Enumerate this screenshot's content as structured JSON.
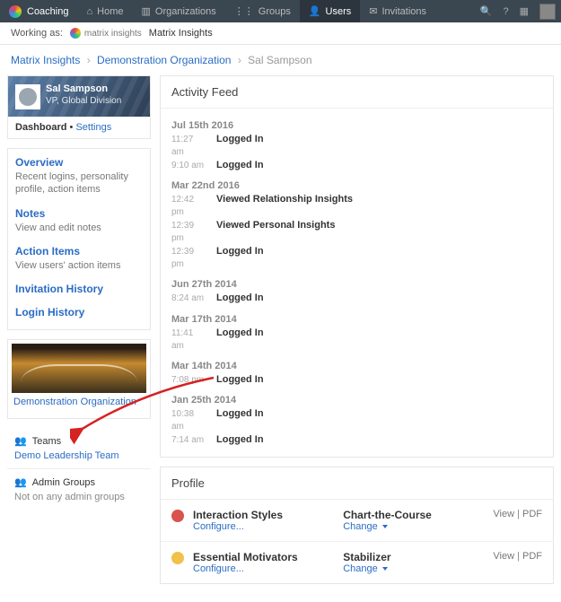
{
  "topnav": {
    "brand": "Coaching",
    "items": [
      {
        "label": "Home",
        "icon": "home-icon"
      },
      {
        "label": "Organizations",
        "icon": "org-icon"
      },
      {
        "label": "Groups",
        "icon": "groups-icon"
      },
      {
        "label": "Users",
        "icon": "user-icon",
        "active": true
      },
      {
        "label": "Invitations",
        "icon": "mail-icon"
      }
    ]
  },
  "working_as": {
    "label": "Working as:",
    "org_name": "Matrix Insights",
    "logo_text": "matrix insights"
  },
  "breadcrumb": {
    "a": "Matrix Insights",
    "b": "Demonstration Organization",
    "c": "Sal Sampson"
  },
  "user": {
    "name": "Sal Sampson",
    "role": "VP, Global Division"
  },
  "dash": {
    "dashboard": "Dashboard",
    "settings": "Settings"
  },
  "sidenav": {
    "overview": {
      "title": "Overview",
      "desc": "Recent logins, personality profile, action items"
    },
    "notes": {
      "title": "Notes",
      "desc": "View and edit notes"
    },
    "actions": {
      "title": "Action Items",
      "desc": "View users' action items"
    },
    "inv": {
      "title": "Invitation History"
    },
    "login": {
      "title": "Login History"
    }
  },
  "org": {
    "name": "Demonstration Organization"
  },
  "teams": {
    "header": "Teams",
    "link": "Demo Leadership Team"
  },
  "admin_groups": {
    "header": "Admin Groups",
    "text": "Not on any admin groups"
  },
  "feed": {
    "header": "Activity Feed",
    "groups": [
      {
        "date": "Jul 15th 2016",
        "rows": [
          {
            "time": "11:27 am",
            "action": "Logged In"
          },
          {
            "time": "9:10 am",
            "action": "Logged In"
          }
        ]
      },
      {
        "date": "Mar 22nd 2016",
        "rows": [
          {
            "time": "12:42 pm",
            "action": "Viewed Relationship Insights"
          },
          {
            "time": "12:39 pm",
            "action": "Viewed Personal Insights"
          },
          {
            "time": "12:39 pm",
            "action": "Logged In"
          }
        ]
      },
      {
        "date": "Jun 27th 2014",
        "rows": [
          {
            "time": "8:24 am",
            "action": "Logged In"
          }
        ]
      },
      {
        "date": "Mar 17th 2014",
        "rows": [
          {
            "time": "11:41 am",
            "action": "Logged In"
          }
        ]
      },
      {
        "date": "Mar 14th 2014",
        "rows": [
          {
            "time": "7:08 pm",
            "action": "Logged In"
          }
        ]
      },
      {
        "date": "Jan 25th 2014",
        "rows": [
          {
            "time": "10:38 am",
            "action": "Logged In"
          },
          {
            "time": "7:14 am",
            "action": "Logged In"
          }
        ]
      }
    ]
  },
  "profile": {
    "header": "Profile",
    "rows": [
      {
        "icon": "red",
        "name": "Interaction Styles",
        "link": "Configure...",
        "val": "Chart-the-Course",
        "val_link": "Change",
        "actions": {
          "view": "View",
          "pdf": "PDF"
        }
      },
      {
        "icon": "yellow",
        "name": "Essential Motivators",
        "link": "Configure...",
        "val": "Stabilizer",
        "val_link": "Change",
        "actions": {
          "view": "View",
          "pdf": "PDF"
        }
      }
    ]
  }
}
